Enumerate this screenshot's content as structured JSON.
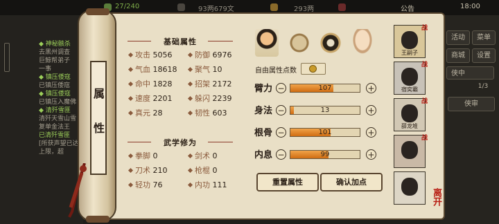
{
  "topbar": {
    "exp": "27/240",
    "coins": "93两679文",
    "gems": "293两",
    "notice": "公告",
    "time": "18:00"
  },
  "quests": [
    {
      "text": "◆ 神秘骸杀",
      "green": true
    },
    {
      "text": "去黑州调查",
      "green": false
    },
    {
      "text": "巨鲸帮弟子",
      "green": false
    },
    {
      "text": "一事",
      "green": false
    },
    {
      "text": "◆ 镇压倭寇",
      "green": true
    },
    {
      "text": "已镇压倭寇",
      "green": false
    },
    {
      "text": "◆ 镇压倭寇",
      "green": true
    },
    {
      "text": "已镇压入魔佛",
      "green": false
    },
    {
      "text": "◆ 清歼雪匪",
      "green": true
    },
    {
      "text": "清歼天雪山雪",
      "green": false
    },
    {
      "text": "复单金法王",
      "green": false
    },
    {
      "text": "已清歼雪匪",
      "green": true
    },
    {
      "text": "[所获声望已达",
      "green": false
    },
    {
      "text": "上限，超",
      "green": false
    }
  ],
  "right_buttons": [
    "活动",
    "菜单",
    "商城",
    "设置",
    "侠中",
    "1/3",
    "侠审"
  ],
  "scroll_label": [
    "属",
    "性"
  ],
  "basic": {
    "title": "基础属性",
    "rows": [
      [
        {
          "k": "攻击",
          "v": "5056"
        },
        {
          "k": "防御",
          "v": "6976"
        }
      ],
      [
        {
          "k": "气血",
          "v": "18618"
        },
        {
          "k": "聚气",
          "v": "10"
        }
      ],
      [
        {
          "k": "命中",
          "v": "1828"
        },
        {
          "k": "招架",
          "v": "2172"
        }
      ],
      [
        {
          "k": "速度",
          "v": "2201"
        },
        {
          "k": "躲闪",
          "v": "2239"
        }
      ],
      [
        {
          "k": "真元",
          "v": "28"
        },
        {
          "k": "韧性",
          "v": "603"
        }
      ]
    ]
  },
  "martial": {
    "title": "武学修为",
    "rows": [
      [
        {
          "k": "拳脚",
          "v": "0"
        },
        {
          "k": "剑术",
          "v": "0"
        }
      ],
      [
        {
          "k": "刀术",
          "v": "210"
        },
        {
          "k": "枪棍",
          "v": "0"
        }
      ],
      [
        {
          "k": "轻功",
          "v": "76"
        },
        {
          "k": "内功",
          "v": "111"
        }
      ]
    ]
  },
  "free_points": {
    "label": "自由属性点数"
  },
  "allocate": [
    {
      "label": "臂力",
      "value": "107",
      "fill": 0.62
    },
    {
      "label": "身法",
      "value": "13",
      "fill": 0.05
    },
    {
      "label": "根骨",
      "value": "101",
      "fill": 0.58
    },
    {
      "label": "内息",
      "value": "99",
      "fill": 0.55
    }
  ],
  "actions": {
    "reset": "重置属性",
    "confirm": "确认加点"
  },
  "party": [
    {
      "name": "王嗣子",
      "zhan": "战"
    },
    {
      "name": "宿奕霸",
      "zhan": "战"
    },
    {
      "name": "薛龙堆",
      "zhan": "战"
    },
    {
      "name": "",
      "zhan": "战"
    },
    {
      "name": "",
      "zhan": ""
    }
  ],
  "leave_label": "离开",
  "colors": {
    "accent": "#d06d12",
    "ink": "#2d2218",
    "seal": "#b81e14"
  }
}
